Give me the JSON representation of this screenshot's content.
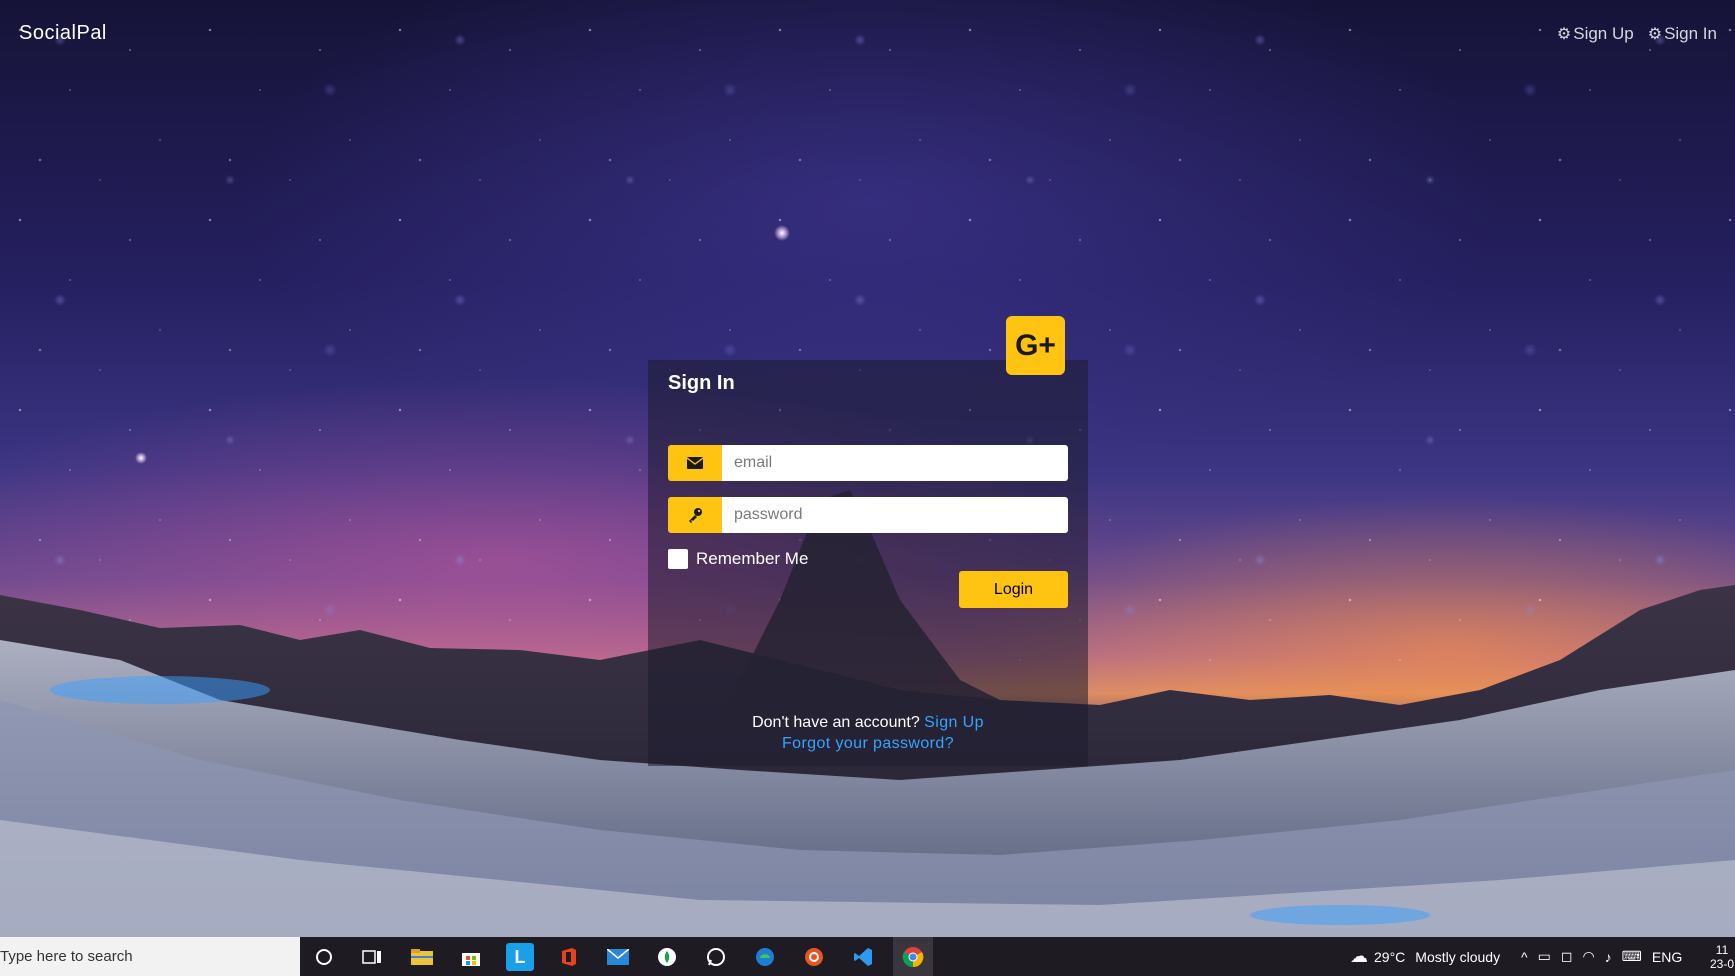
{
  "app": {
    "brand": "SocialPal",
    "nav": [
      {
        "label": "Sign Up",
        "icon": "gear-icon"
      },
      {
        "label": "Sign In",
        "icon": "gear-icon"
      }
    ]
  },
  "signin": {
    "title": "Sign In",
    "social_label": "G+",
    "email_placeholder": "email",
    "password_placeholder": "password",
    "remember_label": "Remember Me",
    "login_label": "Login",
    "no_account_text": "Don't have an account?",
    "signup_link": "Sign Up",
    "forgot_link": "Forgot your password?",
    "accent_color": "#ffc312",
    "link_color": "#34a4ff"
  },
  "taskbar": {
    "search_placeholder": "Type here to search",
    "weather_temp": "29°C",
    "weather_text": "Mostly cloudy",
    "language": "ENG",
    "time_partial": "11",
    "date_partial": "23-0"
  }
}
